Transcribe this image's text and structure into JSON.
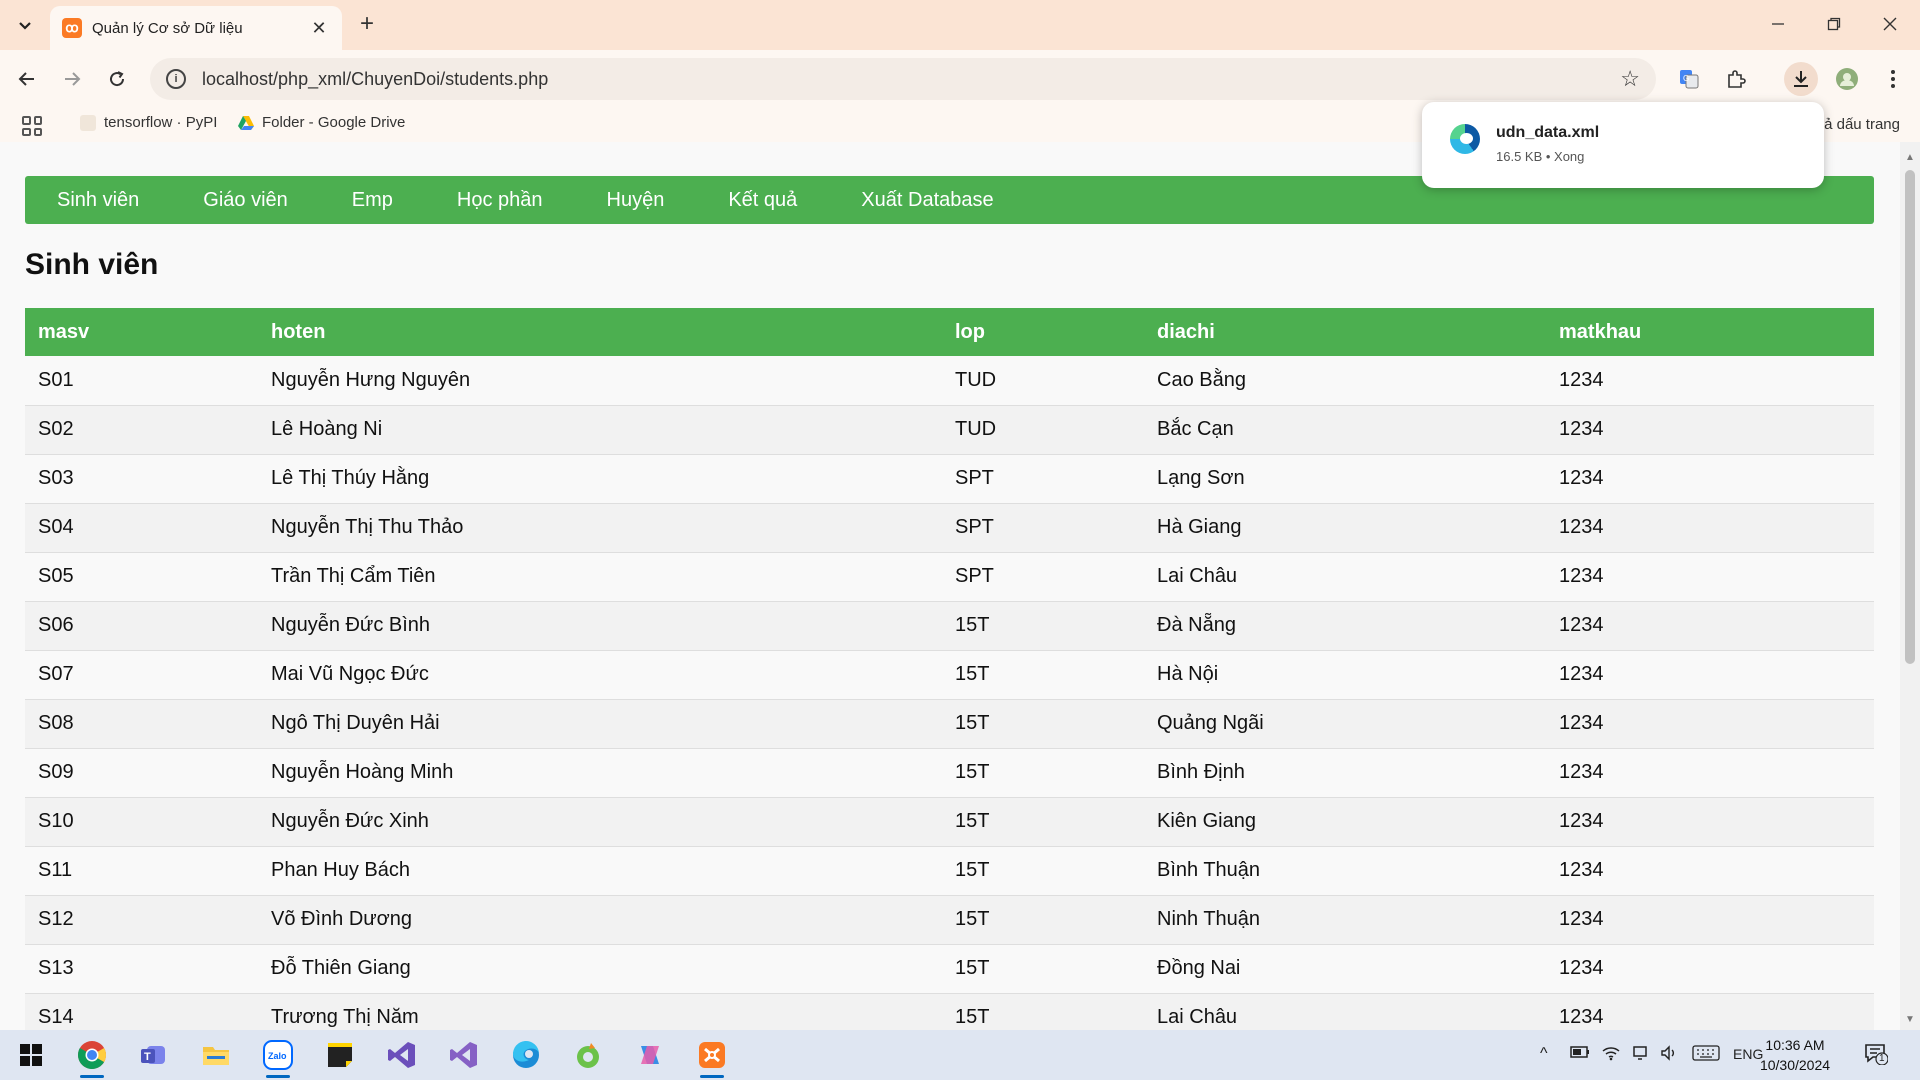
{
  "browser": {
    "tab_title": "Quản lý Cơ sở Dữ liệu",
    "tab_close": "✕",
    "new_tab": "+",
    "url": "localhost/php_xml/ChuyenDoi/students.php",
    "bookmarks": [
      {
        "label": "tensorflow · PyPI"
      },
      {
        "label": "Folder - Google Drive"
      }
    ],
    "bookmarks_right": "ả dấu trang"
  },
  "download": {
    "file_name": "udn_data.xml",
    "meta": "16.5 KB • Xong"
  },
  "nav": {
    "items": [
      "Sinh viên",
      "Giáo viên",
      "Emp",
      "Học phần",
      "Huyện",
      "Kết quả",
      "Xuất Database"
    ]
  },
  "page": {
    "title": "Sinh viên"
  },
  "table": {
    "columns": [
      "masv",
      "hoten",
      "lop",
      "diachi",
      "matkhau"
    ],
    "rows": [
      [
        "S01",
        "Nguyễn Hưng Nguyên",
        "TUD",
        "Cao Bằng",
        "1234"
      ],
      [
        "S02",
        "Lê Hoàng Ni",
        "TUD",
        "Bắc Cạn",
        "1234"
      ],
      [
        "S03",
        "Lê Thị Thúy Hằng",
        "SPT",
        "Lạng Sơn",
        "1234"
      ],
      [
        "S04",
        "Nguyễn Thị Thu Thảo",
        "SPT",
        "Hà Giang",
        "1234"
      ],
      [
        "S05",
        "Trần Thị Cẩm Tiên",
        "SPT",
        "Lai Châu",
        "1234"
      ],
      [
        "S06",
        "Nguyễn Đức Bình",
        "15T",
        "Đà Nẵng",
        "1234"
      ],
      [
        "S07",
        "Mai Vũ Ngọc Đức",
        "15T",
        "Hà Nội",
        "1234"
      ],
      [
        "S08",
        "Ngô Thị Duyên Hải",
        "15T",
        "Quảng Ngãi",
        "1234"
      ],
      [
        "S09",
        "Nguyễn Hoàng Minh",
        "15T",
        "Bình Định",
        "1234"
      ],
      [
        "S10",
        "Nguyễn Đức Xinh",
        "15T",
        "Kiên Giang",
        "1234"
      ],
      [
        "S11",
        "Phan Huy Bách",
        "15T",
        "Bình Thuận",
        "1234"
      ],
      [
        "S12",
        "Võ Đình Dương",
        "15T",
        "Ninh Thuận",
        "1234"
      ],
      [
        "S13",
        "Đỗ Thiên Giang",
        "15T",
        "Đồng Nai",
        "1234"
      ],
      [
        "S14",
        "Trương Thị Năm",
        "15T",
        "Lai Châu",
        "1234"
      ]
    ]
  },
  "taskbar": {
    "language": "ENG",
    "time": "10:36 AM",
    "date": "10/30/2024",
    "notification_count": "1",
    "apps": [
      "start-icon",
      "chrome-icon",
      "teams-icon",
      "file-explorer-icon",
      "zalo-icon",
      "sticky-notes-icon",
      "visual-studio-preview-icon",
      "visual-studio-icon",
      "edge-icon",
      "coccoc-icon",
      "copilot-icon",
      "xampp-icon"
    ]
  },
  "colors": {
    "accent": "#4caf50",
    "tabbar": "#fbe4d4"
  }
}
